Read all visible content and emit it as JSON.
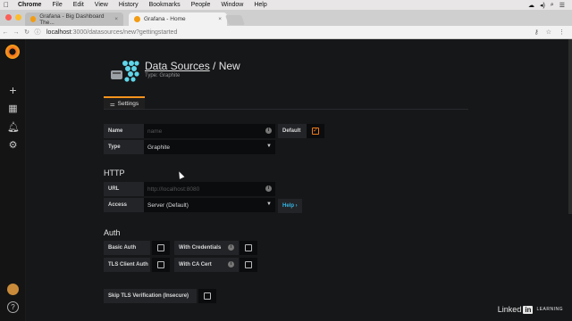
{
  "macmenu": [
    "Chrome",
    "File",
    "Edit",
    "View",
    "History",
    "Bookmarks",
    "People",
    "Window",
    "Help"
  ],
  "browser": {
    "tabs": [
      {
        "title": "Grafana - Big Dashboard The...",
        "active": false
      },
      {
        "title": "Grafana - Home",
        "active": true
      }
    ],
    "url_host": "localhost",
    "url_path": ":3000/datasources/new?gettingstarted"
  },
  "header": {
    "title_link": "Data Sources",
    "title_rest": " / New",
    "subtitle": "Type: Graphite"
  },
  "settings_tab": "Settings",
  "form": {
    "name_label": "Name",
    "name_placeholder": "name",
    "default_label": "Default",
    "type_label": "Type",
    "type_value": "Graphite",
    "http_title": "HTTP",
    "url_label": "URL",
    "url_placeholder": "http://localhost:8080",
    "access_label": "Access",
    "access_value": "Server (Default)",
    "help_label": "Help ›",
    "auth_title": "Auth",
    "basic_auth": "Basic Auth",
    "with_credentials": "With Credentials",
    "tls_client_auth": "TLS Client Auth",
    "with_ca_cert": "With CA Cert",
    "skip_tls": "Skip TLS Verification (Insecure)"
  },
  "watermark": {
    "linked": "Linked",
    "in": "in",
    "learning": "LEARNING"
  },
  "colors": {
    "accent": "#f7941d",
    "help": "#33b5e5",
    "bg": "#161719"
  }
}
